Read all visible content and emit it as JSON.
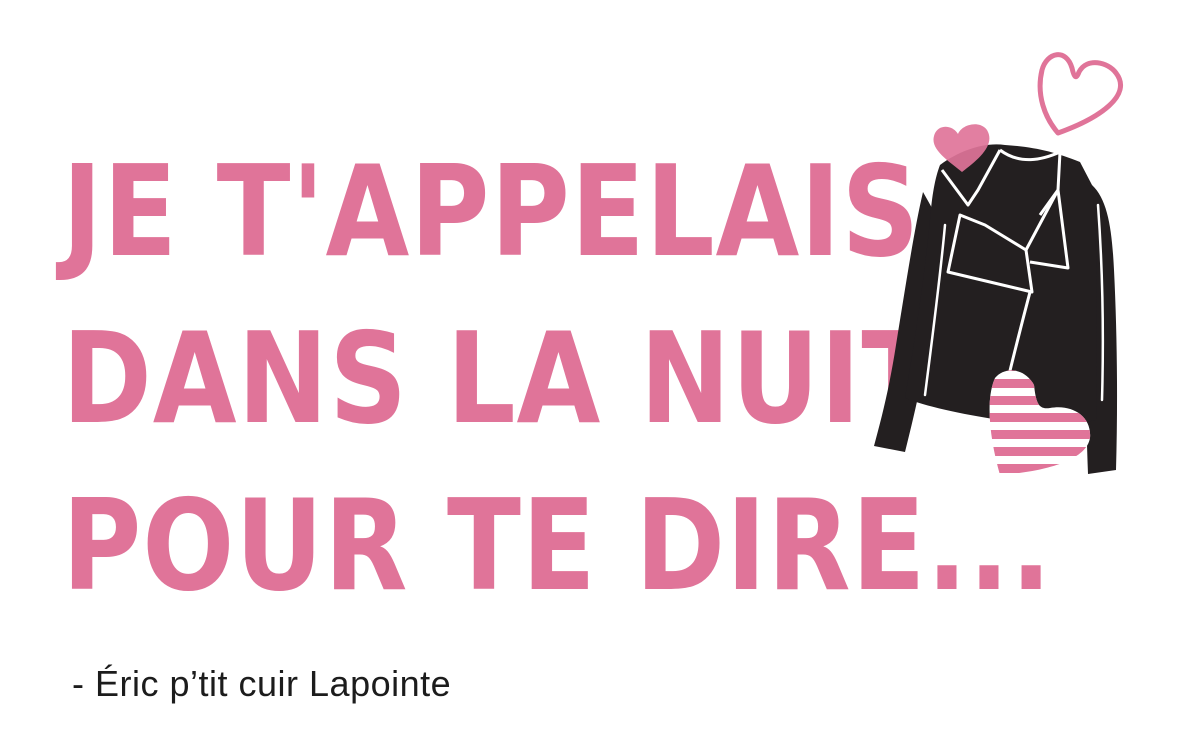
{
  "quote": {
    "lines": [
      "JE T'APPELAIS",
      "DANS LA NUIT",
      "POUR TE DIRE..."
    ],
    "color": "#e07499"
  },
  "author": {
    "text": "- Éric p’tit cuir Lapointe",
    "color": "#1c1c1c"
  },
  "illustration": {
    "icons": [
      "leather-jacket-icon",
      "outline-heart-icon",
      "solid-heart-icon",
      "striped-heart-icon"
    ],
    "jacket_color": "#231f20",
    "heart_color": "#e07499"
  }
}
